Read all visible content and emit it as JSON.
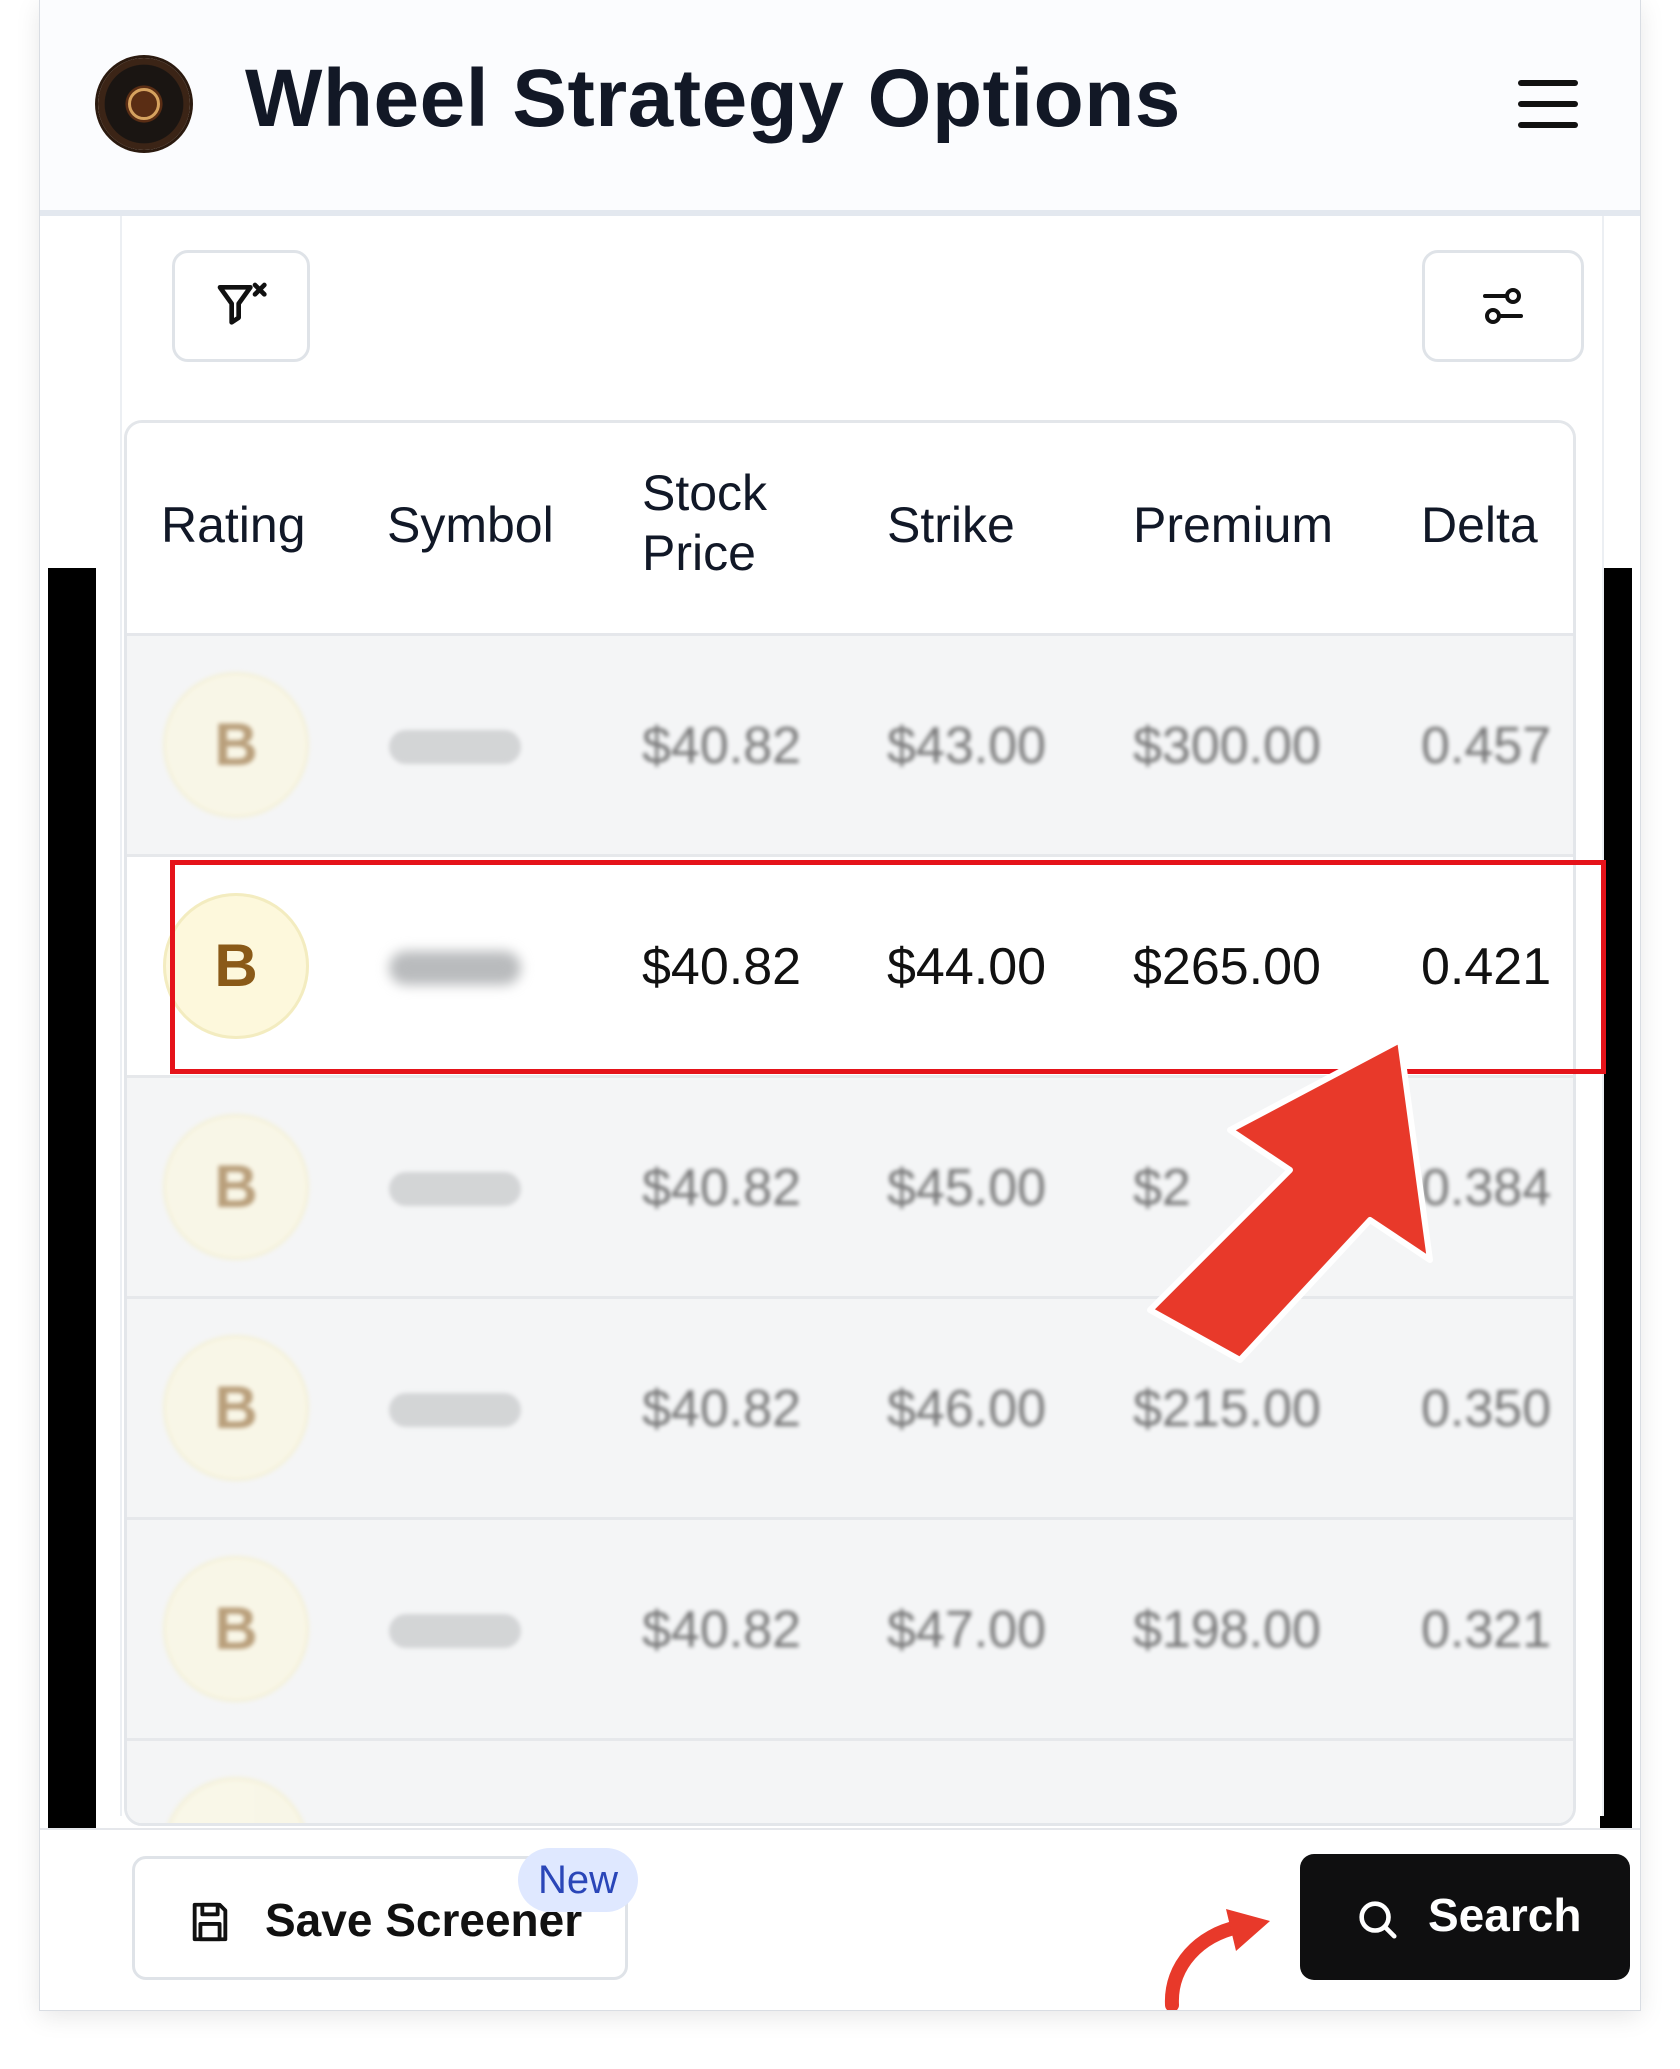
{
  "header": {
    "title": "Wheel Strategy Options"
  },
  "table": {
    "columns": [
      "Rating",
      "Symbol",
      "Stock\nPrice",
      "Strike",
      "Premium",
      "Delta"
    ],
    "rows": [
      {
        "rating": "B",
        "stock_price": "$40.82",
        "strike": "$43.00",
        "premium": "$300.00",
        "delta": "0.457"
      },
      {
        "rating": "B",
        "stock_price": "$40.82",
        "strike": "$44.00",
        "premium": "$265.00",
        "delta": "0.421"
      },
      {
        "rating": "B",
        "stock_price": "$40.82",
        "strike": "$45.00",
        "premium": "$2",
        "delta": "0.384"
      },
      {
        "rating": "B",
        "stock_price": "$40.82",
        "strike": "$46.00",
        "premium": "$215.00",
        "delta": "0.350"
      },
      {
        "rating": "B",
        "stock_price": "$40.82",
        "strike": "$47.00",
        "premium": "$198.00",
        "delta": "0.321"
      }
    ]
  },
  "footer": {
    "save_label": "Save Screener",
    "new_badge": "New",
    "search_label": "Search"
  },
  "colors": {
    "highlight": "#e5131a",
    "arrow": "#e8392a",
    "rating_text": "#8a5a18",
    "rating_bg": "#fdf8dc"
  },
  "icons": [
    "logo",
    "menu-icon",
    "filter-clear-icon",
    "sliders-icon",
    "save-icon",
    "search-icon"
  ]
}
